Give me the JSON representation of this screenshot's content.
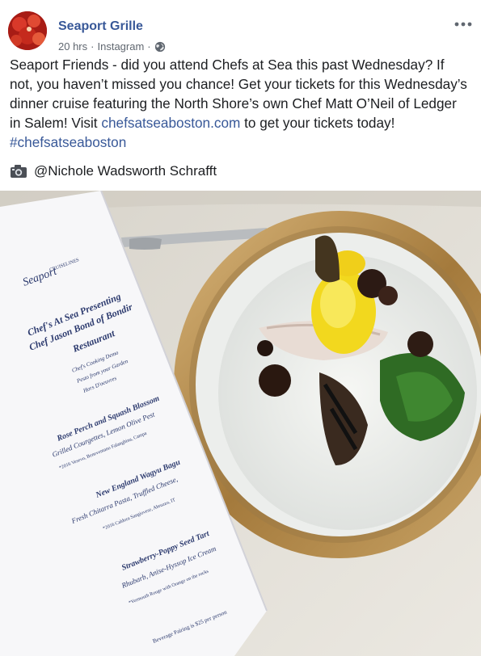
{
  "post": {
    "page_name": "Seaport Grille",
    "time": "20 hrs",
    "source": "Instagram",
    "caption_intro": "Seaport Friends - did you attend Chefs at Sea this past Wednesday? If not, you haven’t missed you chance! Get your tickets for this Wednesday’s dinner cruise featuring the North Shore’s own Chef Matt O’Neil of Ledger in Salem! Visit ",
    "link": "chefsatseaboston.com",
    "caption_mid": " to get your tickets today! ",
    "hashtag": "#chefsatseaboston",
    "credit": "@Nichole Wadsworth Schrafft",
    "icons": [
      "lobster-avatar",
      "globe-icon",
      "more-icon",
      "camera-icon"
    ]
  },
  "menu": {
    "brand": "Seaport",
    "brand_sub": "CRUISELINES",
    "heading1": "Chef's At Sea Presenting",
    "heading2": "Chef Jason Bond of Bondir",
    "heading3": "Restaurant",
    "small1": "Chef's Cooking Demo",
    "small2": "Pesto from your Garden",
    "small3": "Hors D'oeuvres",
    "course1": "Rose Perch and Squash Blossom",
    "course1_desc": "Grilled Courgettes, Lemon Olive Pest",
    "course1_wine": "*2016 Vesevo, Beneventano Falanghina, Campa",
    "course2": "New England Wagyu Bagu",
    "course2_desc": "Fresh Chitarra Pasta, Truffled Cheese,",
    "course2_wine": "*2016 Caldora Sangiovese, Abruzzo, IT",
    "course3": "Strawberry-Poppy Seed Tart",
    "course3_desc": "Rhubarb, Anise-Hyssop Ice Cream",
    "course3_wine": "*Vermouth Rouge with Orange on the rocks",
    "pairing": "Beverage Pairing is $25 per person"
  },
  "colors": {
    "link": "#385898",
    "plate_rim": "#b8935a",
    "menu_text": "#2c3a6e"
  }
}
